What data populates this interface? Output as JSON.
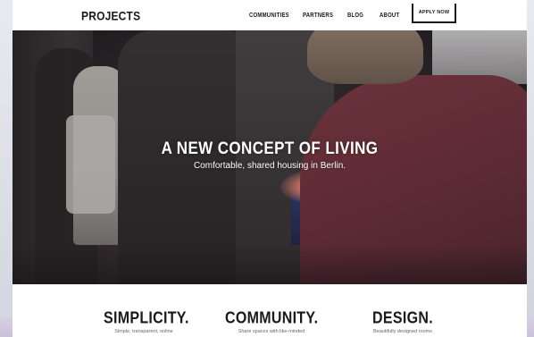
{
  "header": {
    "logo": "PROJECTS",
    "nav": [
      "COMMUNITIES",
      "PARTNERS",
      "BLOG",
      "ABOUT"
    ],
    "cta": "APPLY NOW"
  },
  "hero": {
    "title": "A NEW CONCEPT OF LIVING",
    "subtitle": "Comfortable, shared housing in Berlin."
  },
  "features": [
    {
      "title": "SIMPLICITY.",
      "text": "Simple, transparent, online"
    },
    {
      "title": "COMMUNITY.",
      "text": "Share spaces with like-minded"
    },
    {
      "title": "DESIGN.",
      "text": "Beautifully designed rooms"
    }
  ],
  "colors": {
    "text": "#1a1a1a",
    "sweater": "#6b3039",
    "accent_glow": "#d77d6b"
  }
}
